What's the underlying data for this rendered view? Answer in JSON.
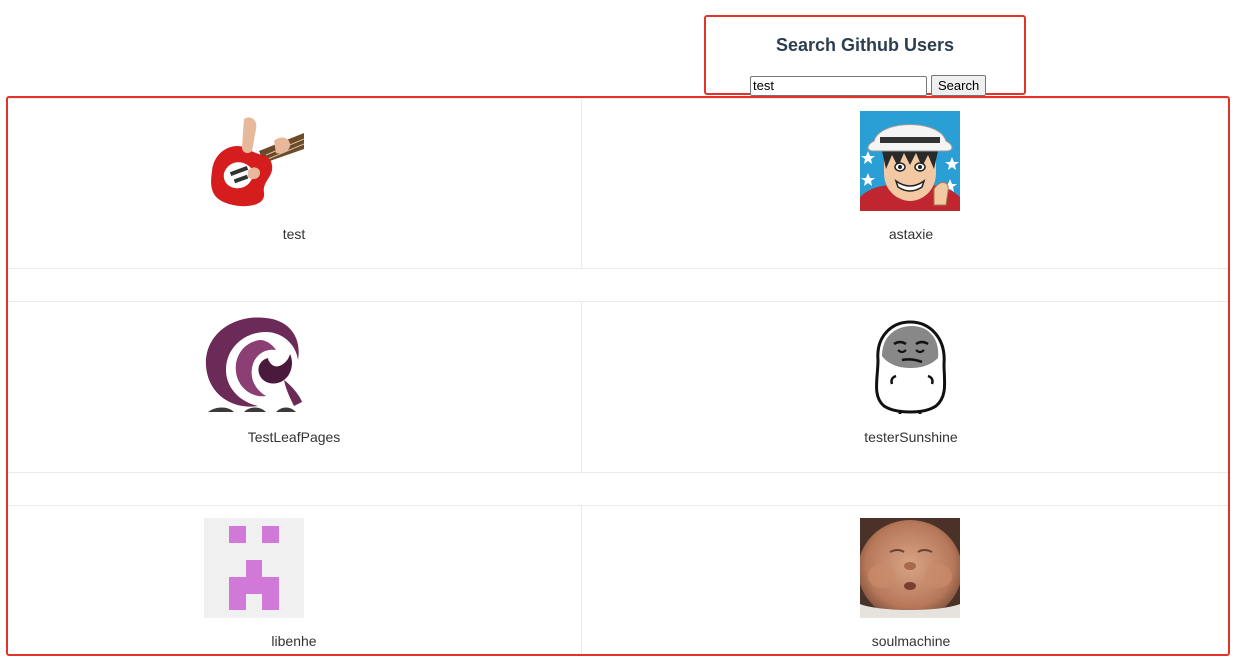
{
  "search": {
    "title": "Search Github Users",
    "input_value": "test",
    "button_label": "Search"
  },
  "users": [
    {
      "login": "test",
      "avatar_icon": "guitar-avatar-icon"
    },
    {
      "login": "astaxie",
      "avatar_icon": "cartoon-face-avatar-icon"
    },
    {
      "login": "TestLeafPages",
      "avatar_icon": "swirl-logo-avatar-icon"
    },
    {
      "login": "testerSunshine",
      "avatar_icon": "meme-face-avatar-icon"
    },
    {
      "login": "libenhe",
      "avatar_icon": "identicon-avatar-icon"
    },
    {
      "login": "soulmachine",
      "avatar_icon": "baby-photo-avatar-icon"
    }
  ],
  "colors": {
    "highlight_border": "#e2332a",
    "title_text": "#2c3e50",
    "card_border": "#eaeaea",
    "identicon": "#d079d8"
  }
}
